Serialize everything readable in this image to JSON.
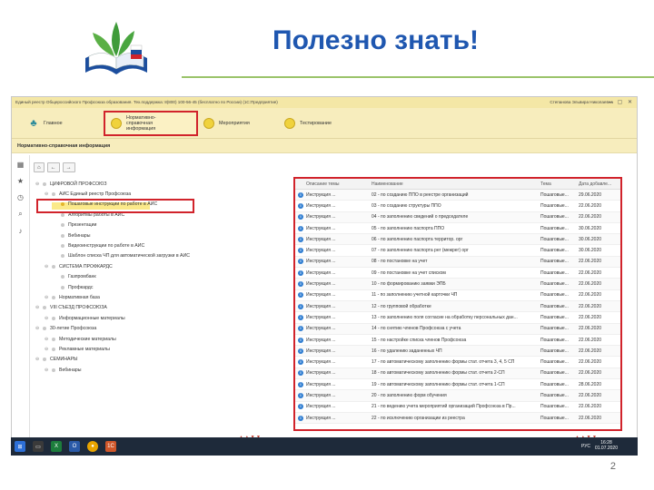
{
  "slide": {
    "title": "Полезно знать!",
    "page_number": "2"
  },
  "app": {
    "window_title": "Единый реестр Общероссийского Профсоюза образования. Тех.поддержка: 8(800) 100-56-45 (бесплатно по России) (1С:Предприятие)",
    "user": "Степанова Эльвира Николаевна",
    "ribbon": [
      {
        "label": "Главное",
        "icon": "home-icon"
      },
      {
        "label": "Нормативно-справочная информация",
        "icon": "circle-icon",
        "active": true
      },
      {
        "label": "Мероприятия",
        "icon": "circle-icon"
      },
      {
        "label": "Тестирование",
        "icon": "circle-icon"
      }
    ],
    "section_title": "Нормативно-справочная информация",
    "toolbar": {
      "home": "⌂",
      "back": "←",
      "forward": "→"
    },
    "tree": [
      {
        "level": 0,
        "label": "ЦИФРОВОЙ ПРОФСОЮЗ"
      },
      {
        "level": 1,
        "label": "АИС Единый реестр Профсоюза"
      },
      {
        "level": 2,
        "label": "Пошаговые инструкции по работе в АИС",
        "highlight": true
      },
      {
        "level": 2,
        "label": "Алгоритмы работы в АИС"
      },
      {
        "level": 2,
        "label": "Презентации"
      },
      {
        "level": 2,
        "label": "Вебинары"
      },
      {
        "level": 2,
        "label": "Видеоинструкции по работе в АИС"
      },
      {
        "level": 2,
        "label": "Шаблон списка ЧП для автоматической загрузки в АИС"
      },
      {
        "level": 1,
        "label": "СИСТЕМА ПРОФКАРДС"
      },
      {
        "level": 2,
        "label": "Газпромбанк"
      },
      {
        "level": 2,
        "label": "Профкардс"
      },
      {
        "level": 1,
        "label": "Нормативная база"
      },
      {
        "level": 0,
        "label": "VIII СЪЕЗД ПРОФСОЮЗА"
      },
      {
        "level": 1,
        "label": "Информационные материалы"
      },
      {
        "level": 0,
        "label": "30-летие Профсоюза"
      },
      {
        "level": 1,
        "label": "Методические материалы"
      },
      {
        "level": 1,
        "label": "Рекламные материалы"
      },
      {
        "level": 0,
        "label": "СЕМИНАРЫ"
      },
      {
        "level": 1,
        "label": "Вебинары"
      }
    ],
    "grid": {
      "columns": [
        "Описание темы",
        "Наименование",
        "Тема",
        "Дата добавле..."
      ],
      "rows": [
        [
          "Инструкция ...",
          "02 - по созданию ППО в реестре организаций",
          "Пошаговые...",
          "29.06.2020"
        ],
        [
          "Инструкция ...",
          "03 - по созданию структуры ППО",
          "Пошаговые...",
          "22.06.2020"
        ],
        [
          "Инструкция ...",
          "04 - по заполнению сведений о председателе",
          "Пошаговые...",
          "22.06.2020"
        ],
        [
          "Инструкция ...",
          "05 - по заполнению паспорта ППО",
          "Пошаговые...",
          "30.06.2020"
        ],
        [
          "Инструкция ...",
          "06 - по заполнению паспорта территор. орг",
          "Пошаговые...",
          "30.06.2020"
        ],
        [
          "Инструкция ...",
          "07 - по заполнению паспорта рег (межрег) орг",
          "Пошаговые...",
          "30.06.2020"
        ],
        [
          "Инструкция ...",
          "08 - по постановке на учет",
          "Пошаговые...",
          "22.06.2020"
        ],
        [
          "Инструкция ...",
          "09 - по постановке на учет списком",
          "Пошаговые...",
          "22.06.2020"
        ],
        [
          "Инструкция ...",
          "10 - по формированию заявки ЭПБ",
          "Пошаговые...",
          "22.06.2020"
        ],
        [
          "Инструкция ...",
          "11 - по заполнению учетной карточки ЧП",
          "Пошаговые...",
          "22.06.2020"
        ],
        [
          "Инструкция ...",
          "12 - по групповой обработке",
          "Пошаговые...",
          "22.06.2020"
        ],
        [
          "Инструкция ...",
          "13 - по заполнению поля согласие на обработку персональных дан...",
          "Пошаговые...",
          "22.06.2020"
        ],
        [
          "Инструкция ...",
          "14 - по снятию членов Профсоюза с учета",
          "Пошаговые...",
          "22.06.2020"
        ],
        [
          "Инструкция ...",
          "15 - по настройке списка членов Профсоюза",
          "Пошаговые...",
          "22.06.2020"
        ],
        [
          "Инструкция ...",
          "16 - по удалению заданенных ЧП",
          "Пошаговые...",
          "22.06.2020"
        ],
        [
          "Инструкция ...",
          "17 - по автоматическому заполнению формы стат. отчета 3, 4, 5 СП",
          "Пошаговые...",
          "22.06.2020"
        ],
        [
          "Инструкция ...",
          "18 - по автоматическому заполнению формы стат. отчета 2-СП",
          "Пошаговые...",
          "22.06.2020"
        ],
        [
          "Инструкция ...",
          "19 - по автоматическому заполнению формы стат. отчета 1-СП",
          "Пошаговые...",
          "28.06.2020"
        ],
        [
          "Инструкция ...",
          "20 - по заполнению форм обучения",
          "Пошаговые...",
          "22.06.2020"
        ],
        [
          "Инструкция ...",
          "21 - по ведению учета мероприятий организаций Профсоюза в Пр...",
          "Пошаговые...",
          "22.06.2020"
        ],
        [
          "Инструкция ...",
          "22 - по исключению организации из реестра",
          "Пошаговые...",
          "22.06.2020"
        ]
      ]
    },
    "taskbar": {
      "lang": "РУС",
      "time": "16:28",
      "date": "01.07.2020"
    }
  },
  "colors": {
    "title_blue": "#1f57b0",
    "highlight_red": "#d1232b",
    "ribbon_yellow": "#f7edbd"
  }
}
